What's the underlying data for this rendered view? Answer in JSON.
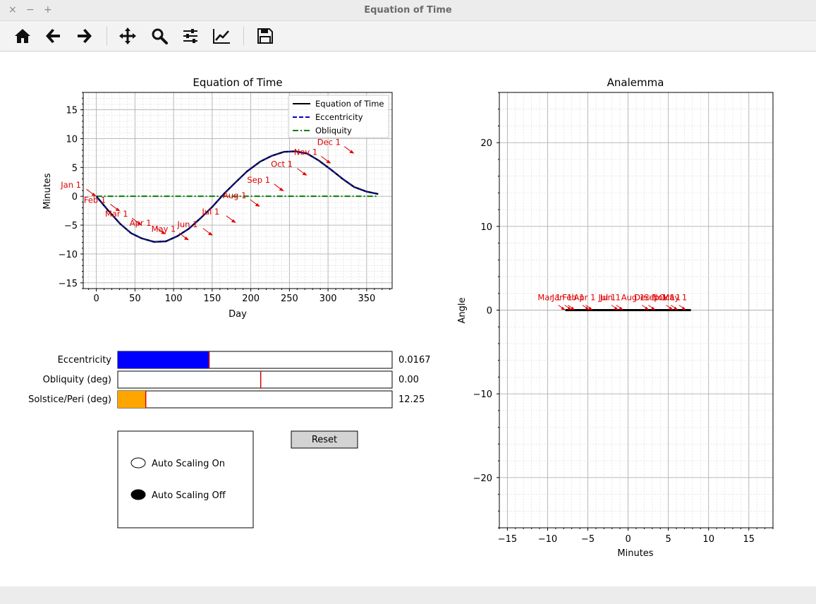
{
  "window": {
    "title": "Equation of Time",
    "close": "×",
    "minimize": "−",
    "maximize": "+"
  },
  "toolbar": {
    "items": [
      "home",
      "back",
      "forward",
      "pan",
      "zoom",
      "configure",
      "edit-curves",
      "save"
    ]
  },
  "left_plot": {
    "title": "Equation of Time",
    "xlabel": "Day",
    "ylabel": "Minutes",
    "xticks": [
      "0",
      "50",
      "100",
      "150",
      "200",
      "250",
      "300",
      "350"
    ],
    "yticks": [
      "−15",
      "−10",
      "−5",
      "0",
      "5",
      "10",
      "15"
    ],
    "legend": [
      "Equation of Time",
      "Eccentricity",
      "Obliquity"
    ],
    "months": [
      "Jan 1",
      "Feb 1",
      "Mar 1",
      "Apr 1",
      "May 1",
      "Jun 1",
      "Jul 1",
      "Aug 1",
      "Sep 1",
      "Oct 1",
      "Nov 1",
      "Dec 1"
    ]
  },
  "right_plot": {
    "title": "Analemma",
    "xlabel": "Minutes",
    "ylabel": "Angle",
    "xticks": [
      "−15",
      "−10",
      "−5",
      "0",
      "5",
      "10",
      "15"
    ],
    "yticks": [
      "−20",
      "−10",
      "0",
      "10",
      "20"
    ]
  },
  "sliders": [
    {
      "label": "Eccentricity",
      "value": "0.0167",
      "fill_fraction": 0.333,
      "fill_color": "#0000ff",
      "marker_fraction": 0.333
    },
    {
      "label": "Obliquity (deg)",
      "value": "0.00",
      "fill_fraction": 0,
      "fill_color": "#0000ff",
      "marker_fraction": 0.521
    },
    {
      "label": "Solstice/Peri (deg)",
      "value": "12.25",
      "fill_fraction": 0.102,
      "fill_color": "#ffa500",
      "marker_fraction": 0.102
    }
  ],
  "radio": {
    "options": [
      "Auto Scaling On",
      "Auto Scaling Off"
    ],
    "selected": 1
  },
  "reset_label": "Reset",
  "chart_data": [
    {
      "type": "line",
      "title": "Equation of Time",
      "xlabel": "Day",
      "ylabel": "Minutes",
      "xlim": [
        -17,
        383
      ],
      "ylim": [
        -16,
        18
      ],
      "legend_position": "top-right",
      "grid": true,
      "series": [
        {
          "name": "Equation of Time",
          "color": "#000000",
          "style": "solid"
        },
        {
          "name": "Eccentricity",
          "color": "#0000cc",
          "style": "dashed"
        },
        {
          "name": "Obliquity",
          "color": "#008000",
          "style": "dashdot",
          "values": [
            0
          ]
        }
      ],
      "x": [
        0,
        15,
        31,
        45,
        59,
        75,
        90,
        105,
        120,
        135,
        151,
        165,
        181,
        195,
        212,
        227,
        243,
        258,
        273,
        288,
        304,
        319,
        334,
        350,
        365
      ],
      "y": [
        0,
        -2.4,
        -4.8,
        -6.4,
        -7.3,
        -7.9,
        -7.8,
        -6.9,
        -5.6,
        -3.8,
        -1.7,
        0.4,
        2.5,
        4.3,
        6.0,
        7.0,
        7.7,
        7.8,
        7.4,
        6.2,
        4.6,
        3.0,
        1.6,
        0.8,
        0.4
      ],
      "annotations": [
        {
          "text": "Jan 1",
          "x": 0,
          "y": 0
        },
        {
          "text": "Feb 1",
          "x": 31,
          "y": -2.6
        },
        {
          "text": "Mar 1",
          "x": 59,
          "y": -5.0
        },
        {
          "text": "Apr 1",
          "x": 90,
          "y": -6.6
        },
        {
          "text": "May 1",
          "x": 120,
          "y": -7.6
        },
        {
          "text": "Jun 1",
          "x": 151,
          "y": -6.8
        },
        {
          "text": "Jul 1",
          "x": 181,
          "y": -4.6
        },
        {
          "text": "Aug 1",
          "x": 212,
          "y": -1.8
        },
        {
          "text": "Sep 1",
          "x": 243,
          "y": 0.9
        },
        {
          "text": "Oct 1",
          "x": 273,
          "y": 3.6
        },
        {
          "text": "Nov 1",
          "x": 304,
          "y": 5.7
        },
        {
          "text": "Dec 1",
          "x": 334,
          "y": 7.4
        }
      ]
    },
    {
      "type": "line",
      "title": "Analemma",
      "xlabel": "Minutes",
      "ylabel": "Angle",
      "xlim": [
        -16,
        18
      ],
      "ylim": [
        -26,
        26
      ],
      "grid": true,
      "x": [
        -7.8,
        7.8
      ],
      "y": [
        0,
        0
      ],
      "annotations_x": [
        -7.8,
        -7.0,
        -6.6,
        -4.8,
        -4.4,
        -1.2,
        -0.6,
        2.6,
        3.4,
        5.6,
        6.2,
        7.2
      ]
    }
  ]
}
